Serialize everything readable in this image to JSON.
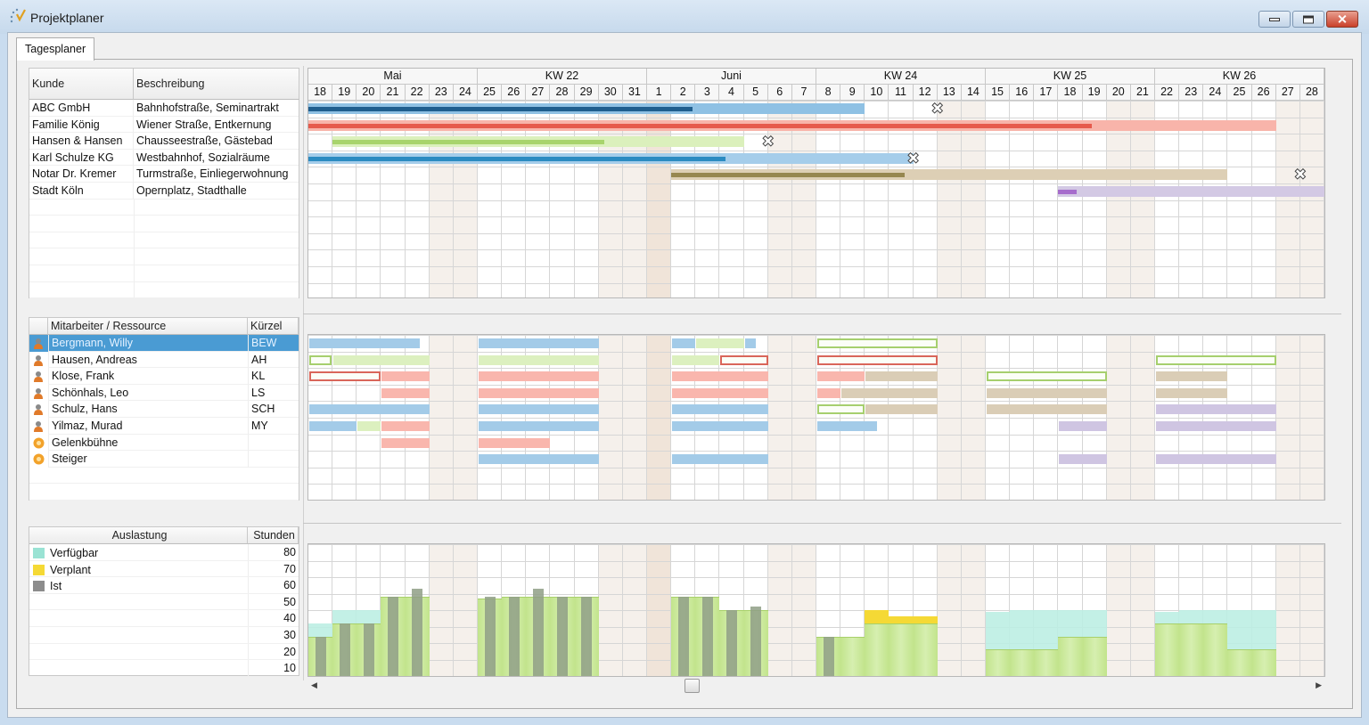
{
  "window": {
    "title": "Projektplaner",
    "icon": "app-logo-icon",
    "controls": [
      "minimize-icon",
      "maximize-icon",
      "close-icon"
    ]
  },
  "tabs": [
    {
      "label": "Tagesplaner",
      "active": true
    }
  ],
  "calendar": {
    "groups": [
      {
        "label": "Mai",
        "from": "18.05",
        "to": "24.05"
      },
      {
        "label": "KW 22",
        "from": "25.05",
        "to": "31.05"
      },
      {
        "label": "Juni",
        "from": "01.06",
        "to": "07.06"
      },
      {
        "label": "KW 24",
        "from": "08.06",
        "to": "14.06"
      },
      {
        "label": "KW 25",
        "from": "15.06",
        "to": "21.06"
      },
      {
        "label": "KW 26",
        "from": "22.06",
        "to": "28.06"
      }
    ],
    "days": [
      "18.05",
      "19.05",
      "20.05",
      "21.05",
      "22.05",
      "23.05",
      "24.05",
      "25.05",
      "26.05",
      "27.05",
      "28.05",
      "29.05",
      "30.05",
      "31.05",
      "01.06",
      "02.06",
      "03.06",
      "04.06",
      "05.06",
      "06.06",
      "07.06",
      "08.06",
      "09.06",
      "10.06",
      "11.06",
      "12.06",
      "13.06",
      "14.06",
      "15.06",
      "16.06",
      "17.06",
      "18.06",
      "19.06",
      "20.06",
      "21.06",
      "22.06",
      "23.06",
      "24.06",
      "25.06",
      "26.06",
      "27.06",
      "28.06"
    ],
    "weekend_days": [
      "23.05",
      "24.05",
      "30.05",
      "31.05",
      "06.06",
      "07.06",
      "13.06",
      "14.06",
      "20.06",
      "21.06",
      "27.06",
      "28.06"
    ],
    "holidays": [
      "01.06"
    ],
    "colors": {
      "weekend": "#f5f0eb",
      "holiday": "#f0e4d9"
    }
  },
  "projects": {
    "headers": {
      "kunde": "Kunde",
      "beschreibung": "Beschreibung"
    },
    "rows": [
      {
        "kunde": "ABC GmbH",
        "beschreibung": "Bahnhofstraße, Seminartrakt",
        "from": "18.05",
        "to": "09.06",
        "progress_pct": 69,
        "milestone": "12.06",
        "color": "#8fc1e4",
        "dark": "#1f5e8e"
      },
      {
        "kunde": "Familie König",
        "beschreibung": "Wiener Straße, Entkernung",
        "from": "18.05",
        "to": "26.06",
        "progress_pct": 81,
        "color": "#f8b4aa",
        "dark": "#e65a4c"
      },
      {
        "kunde": "Hansen & Hansen",
        "beschreibung": "Chausseestraße, Gästebad",
        "from": "19.05",
        "to": "04.06",
        "progress_pct": 66,
        "milestone": "05.06",
        "color": "#dbf0bc",
        "dark": "#a8d46c"
      },
      {
        "kunde": "Karl Schulze KG",
        "beschreibung": "Westbahnhof, Sozialräume",
        "from": "18.05",
        "to": "11.06",
        "progress_pct": 69,
        "milestone": "11.06",
        "color": "#a5cdea",
        "dark": "#2b8bc1"
      },
      {
        "kunde": "Notar Dr. Kremer",
        "beschreibung": "Turmstraße, Einliegerwohnung",
        "from": "02.06",
        "to": "24.06",
        "progress_pct": 42,
        "milestone": "27.06",
        "color": "#ddcfb5",
        "dark": "#968750"
      },
      {
        "kunde": "Stadt Köln",
        "beschreibung": "Opernplatz, Stadthalle",
        "from": "18.06",
        "to": "28.06",
        "progress_pct": 7,
        "color": "#d3c9e4",
        "dark": "#a66ccc"
      }
    ]
  },
  "resources": {
    "headers": {
      "name": "Mitarbeiter / Ressource",
      "kuerzel": "Kürzel"
    },
    "bar_colors": {
      "blue": "#a3cbe8",
      "green": "#dcf0bf",
      "pink": "#f9b6ad",
      "tan": "#dacdb6",
      "purple": "#cfc5e2",
      "outline-green": "#a6cf6e",
      "outline-red": "#d9665a"
    },
    "rows": [
      {
        "name": "Bergmann, Willy",
        "kuerzel": "BEW",
        "icon": "person-icon",
        "selected": true,
        "bars": [
          {
            "from": "18.05",
            "to": "22.05",
            "type": "blue",
            "end_fraction": 0.6
          },
          {
            "from": "25.05",
            "to": "29.05",
            "type": "blue"
          },
          {
            "from": "02.06",
            "to": "02.06",
            "type": "blue"
          },
          {
            "from": "03.06",
            "to": "04.06",
            "type": "green"
          },
          {
            "from": "05.06",
            "to": "05.06",
            "type": "blue",
            "end_fraction": 0.5
          },
          {
            "from": "08.06",
            "to": "12.06",
            "type": "outline-green"
          }
        ]
      },
      {
        "name": "Hausen, Andreas",
        "kuerzel": "AH",
        "icon": "person-icon",
        "bars": [
          {
            "from": "18.05",
            "to": "18.05",
            "type": "outline-green",
            "end_fraction": 0.95
          },
          {
            "from": "19.05",
            "to": "22.05",
            "type": "green"
          },
          {
            "from": "25.05",
            "to": "29.05",
            "type": "green"
          },
          {
            "from": "02.06",
            "to": "03.06",
            "type": "green"
          },
          {
            "from": "04.06",
            "to": "05.06",
            "type": "outline-red"
          },
          {
            "from": "08.06",
            "to": "12.06",
            "type": "outline-red"
          },
          {
            "from": "22.06",
            "to": "26.06",
            "type": "outline-green"
          }
        ]
      },
      {
        "name": "Klose, Frank",
        "kuerzel": "KL",
        "icon": "person-icon",
        "bars": [
          {
            "from": "18.05",
            "to": "20.05",
            "type": "outline-red"
          },
          {
            "from": "21.05",
            "to": "22.05",
            "type": "pink"
          },
          {
            "from": "25.05",
            "to": "29.05",
            "type": "pink"
          },
          {
            "from": "02.06",
            "to": "05.06",
            "type": "pink"
          },
          {
            "from": "08.06",
            "to": "09.06",
            "type": "pink"
          },
          {
            "from": "10.06",
            "to": "12.06",
            "type": "tan"
          },
          {
            "from": "15.06",
            "to": "19.06",
            "type": "outline-green"
          },
          {
            "from": "22.06",
            "to": "24.06",
            "type": "tan"
          }
        ]
      },
      {
        "name": "Schönhals, Leo",
        "kuerzel": "LS",
        "icon": "person-icon",
        "bars": [
          {
            "from": "21.05",
            "to": "22.05",
            "type": "pink"
          },
          {
            "from": "25.05",
            "to": "29.05",
            "type": "pink"
          },
          {
            "from": "02.06",
            "to": "05.06",
            "type": "pink"
          },
          {
            "from": "08.06",
            "to": "08.06",
            "type": "pink"
          },
          {
            "from": "09.06",
            "to": "12.06",
            "type": "tan"
          },
          {
            "from": "15.06",
            "to": "19.06",
            "type": "tan"
          },
          {
            "from": "22.06",
            "to": "24.06",
            "type": "tan"
          }
        ]
      },
      {
        "name": "Schulz, Hans",
        "kuerzel": "SCH",
        "icon": "person-icon",
        "bars": [
          {
            "from": "18.05",
            "to": "22.05",
            "type": "blue"
          },
          {
            "from": "25.05",
            "to": "29.05",
            "type": "blue"
          },
          {
            "from": "02.06",
            "to": "05.06",
            "type": "blue"
          },
          {
            "from": "08.06",
            "to": "09.06",
            "type": "outline-green"
          },
          {
            "from": "10.06",
            "to": "12.06",
            "type": "tan"
          },
          {
            "from": "15.06",
            "to": "19.06",
            "type": "tan"
          },
          {
            "from": "22.06",
            "to": "26.06",
            "type": "purple"
          }
        ]
      },
      {
        "name": "Yilmaz, Murad",
        "kuerzel": "MY",
        "icon": "person-icon",
        "bars": [
          {
            "from": "18.05",
            "to": "19.05",
            "type": "blue"
          },
          {
            "from": "20.05",
            "to": "20.05",
            "type": "green"
          },
          {
            "from": "21.05",
            "to": "22.05",
            "type": "pink"
          },
          {
            "from": "25.05",
            "to": "29.05",
            "type": "blue"
          },
          {
            "from": "02.06",
            "to": "05.06",
            "type": "blue"
          },
          {
            "from": "08.06",
            "to": "10.06",
            "type": "blue",
            "end_fraction": 0.5
          },
          {
            "from": "18.06",
            "to": "19.06",
            "type": "purple"
          },
          {
            "from": "22.06",
            "to": "26.06",
            "type": "purple"
          }
        ]
      },
      {
        "name": "Gelenkbühne",
        "kuerzel": "",
        "icon": "machine-icon",
        "bars": [
          {
            "from": "21.05",
            "to": "22.05",
            "type": "pink"
          },
          {
            "from": "25.05",
            "to": "27.05",
            "type": "pink"
          }
        ]
      },
      {
        "name": "Steiger",
        "kuerzel": "",
        "icon": "machine-icon",
        "bars": [
          {
            "from": "25.05",
            "to": "29.05",
            "type": "blue"
          },
          {
            "from": "02.06",
            "to": "05.06",
            "type": "blue"
          },
          {
            "from": "18.06",
            "to": "19.06",
            "type": "purple"
          },
          {
            "from": "22.06",
            "to": "26.06",
            "type": "purple"
          }
        ]
      }
    ]
  },
  "utilization": {
    "headers": {
      "name": "Auslastung",
      "stunden": "Stunden"
    },
    "legend": [
      {
        "label": "Verfügbar",
        "color": "#9ae3d4"
      },
      {
        "label": "Verplant",
        "color": "#f5d935"
      },
      {
        "label": "Ist",
        "color": "#8c8c8c"
      }
    ],
    "scale_labels": [
      "80",
      "70",
      "60",
      "50",
      "40",
      "30",
      "20",
      "10"
    ],
    "chart_data": {
      "type": "bar",
      "ylim": [
        0,
        80
      ],
      "ylabel": "Stunden",
      "overlap_color": "#c5e690",
      "days": [
        {
          "date": "18.05",
          "available": 32,
          "planned": 24,
          "actual": 24
        },
        {
          "date": "19.05",
          "available": 40,
          "planned": 32,
          "actual": 32
        },
        {
          "date": "20.05",
          "available": 40,
          "planned": 32,
          "actual": 32
        },
        {
          "date": "21.05",
          "available": 48,
          "planned": 48,
          "actual": 48
        },
        {
          "date": "22.05",
          "available": 48,
          "planned": 48,
          "actual": 53
        },
        {
          "date": "25.05",
          "available": 47,
          "planned": 47,
          "actual": 48
        },
        {
          "date": "26.05",
          "available": 48,
          "planned": 48,
          "actual": 48
        },
        {
          "date": "27.05",
          "available": 48,
          "planned": 48,
          "actual": 53
        },
        {
          "date": "28.05",
          "available": 48,
          "planned": 48,
          "actual": 48
        },
        {
          "date": "29.05",
          "available": 48,
          "planned": 48,
          "actual": 48
        },
        {
          "date": "02.06",
          "available": 48,
          "planned": 48,
          "actual": 48
        },
        {
          "date": "03.06",
          "available": 48,
          "planned": 48,
          "actual": 48
        },
        {
          "date": "04.06",
          "available": 40,
          "planned": 40,
          "actual": 40
        },
        {
          "date": "05.06",
          "available": 40,
          "planned": 40,
          "actual": 42
        },
        {
          "date": "08.06",
          "available": 24,
          "planned": 24,
          "actual": 24
        },
        {
          "date": "09.06",
          "available": 24,
          "planned": 24
        },
        {
          "date": "10.06",
          "available": 32,
          "planned": 40
        },
        {
          "date": "11.06",
          "available": 32,
          "planned": 36
        },
        {
          "date": "12.06",
          "available": 32,
          "planned": 36
        },
        {
          "date": "15.06",
          "available": 39,
          "planned": 16
        },
        {
          "date": "16.06",
          "available": 40,
          "planned": 16
        },
        {
          "date": "17.06",
          "available": 40,
          "planned": 16
        },
        {
          "date": "18.06",
          "available": 40,
          "planned": 24
        },
        {
          "date": "19.06",
          "available": 40,
          "planned": 24
        },
        {
          "date": "22.06",
          "available": 39,
          "planned": 32
        },
        {
          "date": "23.06",
          "available": 40,
          "planned": 32
        },
        {
          "date": "24.06",
          "available": 40,
          "planned": 32
        },
        {
          "date": "25.06",
          "available": 40,
          "planned": 16
        },
        {
          "date": "26.06",
          "available": 40,
          "planned": 16
        }
      ]
    }
  },
  "scrollbar": {
    "position_pct": 37
  }
}
